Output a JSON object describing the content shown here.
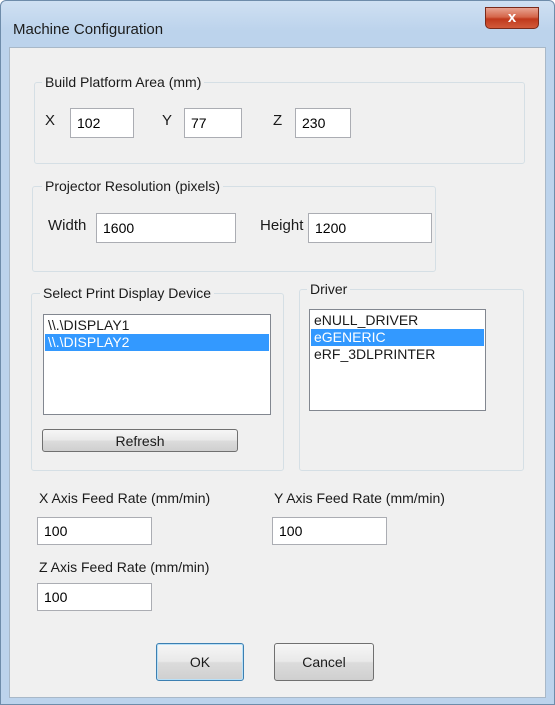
{
  "window": {
    "title": "Machine Configuration",
    "close_label": "x"
  },
  "build_platform": {
    "group_label": "Build Platform Area (mm)",
    "x_label": "X",
    "x_value": "102",
    "y_label": "Y",
    "y_value": "77",
    "z_label": "Z",
    "z_value": "230"
  },
  "projector": {
    "group_label": "Projector Resolution (pixels)",
    "width_label": "Width",
    "width_value": "1600",
    "height_label": "Height",
    "height_value": "1200"
  },
  "display_device": {
    "group_label": "Select Print Display Device",
    "items": [
      "\\\\.\\DISPLAY1",
      "\\\\.\\DISPLAY2"
    ],
    "selected_index": 1,
    "refresh_label": "Refresh"
  },
  "driver": {
    "group_label": "Driver",
    "items": [
      "eNULL_DRIVER",
      "eGENERIC",
      "eRF_3DLPRINTER"
    ],
    "selected_index": 1
  },
  "feed_rates": {
    "x_label": "X Axis Feed Rate (mm/min)",
    "x_value": "100",
    "y_label": "Y Axis Feed Rate (mm/min)",
    "y_value": "100",
    "z_label": "Z Axis Feed Rate (mm/min)",
    "z_value": "100"
  },
  "buttons": {
    "ok_label": "OK",
    "cancel_label": "Cancel"
  }
}
